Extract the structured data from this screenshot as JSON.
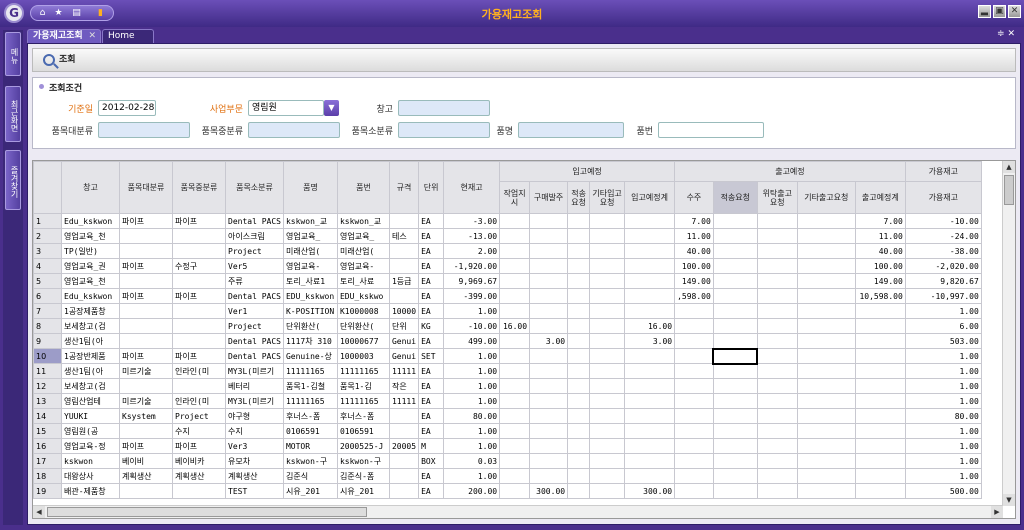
{
  "window": {
    "title": "가용재고조회",
    "logo": "G",
    "min": "▂",
    "max": "▣",
    "close": "✕"
  },
  "quickbar": {
    "icons": [
      "home-icon",
      "star-icon",
      "chart-icon",
      "folder-icon"
    ],
    "glyphs": [
      "⌂",
      "★",
      "▤",
      "▮"
    ]
  },
  "sidebar": {
    "items": [
      "메뉴",
      "최근화면",
      "즐겨찾기"
    ]
  },
  "tabs": [
    {
      "label": "가용재고조회",
      "close": "✕"
    },
    {
      "label": "Home"
    }
  ],
  "tab_controls": "≑ ✕",
  "toolbar": {
    "search_label": "조회"
  },
  "conditions": {
    "title": "조회조건",
    "base_date_label": "기준일",
    "base_date_value": "2012-02-28",
    "division_label": "사업부문",
    "division_value": "영림원",
    "warehouse_label": "창고",
    "cat_large_label": "품목대분류",
    "cat_mid_label": "품목중분류",
    "cat_small_label": "품목소분류",
    "item_name_label": "품명",
    "item_no_label": "품번"
  },
  "grid": {
    "headers": {
      "warehouse": "창고",
      "large": "품목대분류",
      "mid": "품목중분류",
      "small": "품목소분류",
      "name": "품명",
      "no": "품번",
      "spec": "규격",
      "unit": "단위",
      "stock": "현재고",
      "in_group": "입고예정",
      "in_cols": [
        "작업지시",
        "구매발주",
        "적송요청",
        "기타입고요청",
        "입고예정계"
      ],
      "out_group": "출고예정",
      "out_cols": [
        "수주",
        "적송요청",
        "위탁출고요청",
        "기타출고요청",
        "출고예정계"
      ],
      "avail_group": "가용재고",
      "avail": "가용재고"
    },
    "rows": [
      [
        "1",
        "Edu_kskwon",
        "파이프",
        "파이프",
        "Dental PACS",
        "kskwon_교",
        "kskwon_교",
        "",
        "EA",
        "-3.00",
        "",
        "",
        "",
        "",
        "",
        "7.00",
        "",
        "",
        "",
        "7.00",
        "-10.00"
      ],
      [
        "2",
        "영업교육_천",
        "",
        "",
        "아이스크림",
        "영업교육_",
        "영업교육_",
        "테스",
        "EA",
        "-13.00",
        "",
        "",
        "",
        "",
        "",
        "11.00",
        "",
        "",
        "",
        "11.00",
        "-24.00"
      ],
      [
        "3",
        "TP(일반)",
        "",
        "",
        "Project",
        "미래산업(",
        "미래산업(",
        "",
        "EA",
        "2.00",
        "",
        "",
        "",
        "",
        "",
        "40.00",
        "",
        "",
        "",
        "40.00",
        "-38.00"
      ],
      [
        "4",
        "영업교육_권",
        "파이프",
        "수정구",
        "Ver5",
        "영업교육-",
        "영업교육-",
        "",
        "EA",
        "-1,920.00",
        "",
        "",
        "",
        "",
        "",
        "100.00",
        "",
        "",
        "",
        "100.00",
        "-2,020.00"
      ],
      [
        "5",
        "영업교육_천",
        "",
        "",
        "주류",
        "토리_사료1",
        "토리_사료",
        "1등급",
        "EA",
        "9,969.67",
        "",
        "",
        "",
        "",
        "",
        "149.00",
        "",
        "",
        "",
        "149.00",
        "9,820.67"
      ],
      [
        "6",
        "Edu_kskwon",
        "파이프",
        "파이프",
        "Dental PACS",
        "EDU_kskwon",
        "EDU_kskwo",
        "",
        "EA",
        "-399.00",
        "",
        "",
        "",
        "",
        "",
        ",598.00",
        "",
        "",
        "",
        "10,598.00",
        "-10,997.00"
      ],
      [
        "7",
        "1공장제품창",
        "",
        "",
        "Ver1",
        "K-POSITION",
        "K1000008",
        "10000",
        "EA",
        "1.00",
        "",
        "",
        "",
        "",
        "",
        "",
        "",
        "",
        "",
        "",
        "1.00"
      ],
      [
        "8",
        "보세창고(검",
        "",
        "",
        "Project",
        "단위환산(",
        "단위환산(",
        "단위",
        "KG",
        "-10.00",
        "16.00",
        "",
        "",
        "",
        "16.00",
        "",
        "",
        "",
        "",
        "",
        "6.00"
      ],
      [
        "9",
        "생산1팀(아",
        "",
        "",
        "Dental PACS",
        "1117차 310",
        "10000677",
        "Genui",
        "EA",
        "499.00",
        "",
        "3.00",
        "",
        "",
        "3.00",
        "",
        "",
        "",
        "",
        "",
        "503.00"
      ],
      [
        "10",
        "1공장반제품",
        "파이프",
        "파이프",
        "Dental PACS",
        "Genuine-상",
        "1000003",
        "Genui",
        "SET",
        "1.00",
        "",
        "",
        "",
        "",
        "",
        "",
        "",
        "",
        "",
        "",
        "1.00"
      ],
      [
        "11",
        "생산1팀(아",
        "미르기술",
        "인라인(미",
        "MY3L(미르기",
        "11111165",
        "11111165",
        "11111",
        "EA",
        "1.00",
        "",
        "",
        "",
        "",
        "",
        "",
        "",
        "",
        "",
        "",
        "1.00"
      ],
      [
        "12",
        "보세창고(검",
        "",
        "",
        "베터리",
        "품목1-김철",
        "품목1-김",
        "작은",
        "EA",
        "1.00",
        "",
        "",
        "",
        "",
        "",
        "",
        "",
        "",
        "",
        "",
        "1.00"
      ],
      [
        "13",
        "영림산업테",
        "미르기술",
        "인라인(미",
        "MY3L(미르기",
        "11111165",
        "11111165",
        "11111",
        "EA",
        "1.00",
        "",
        "",
        "",
        "",
        "",
        "",
        "",
        "",
        "",
        "",
        "1.00"
      ],
      [
        "14",
        "YUUKI",
        "Ksystem",
        "Project",
        "야구형",
        "후너스-폼",
        "후너스-폼",
        "",
        "EA",
        "80.00",
        "",
        "",
        "",
        "",
        "",
        "",
        "",
        "",
        "",
        "",
        "80.00"
      ],
      [
        "15",
        "영림원(공",
        "",
        "수지",
        "수지",
        "0106591",
        "0106591",
        "",
        "EA",
        "1.00",
        "",
        "",
        "",
        "",
        "",
        "",
        "",
        "",
        "",
        "",
        "1.00"
      ],
      [
        "16",
        "영업교육-정",
        "파이프",
        "파이프",
        "Ver3",
        "MOTOR",
        "2000525-J",
        "20005",
        "M",
        "1.00",
        "",
        "",
        "",
        "",
        "",
        "",
        "",
        "",
        "",
        "",
        "1.00"
      ],
      [
        "17",
        "kskwon",
        "베이비",
        "베이비카",
        "유모차",
        "kskwon-구",
        "kskwon-구",
        "",
        "BOX",
        "0.03",
        "",
        "",
        "",
        "",
        "",
        "",
        "",
        "",
        "",
        "",
        "1.00"
      ],
      [
        "18",
        "대왕상사",
        "계획생산",
        "계획생산",
        "계획생산",
        "김준식",
        "김준식-폼",
        "",
        "EA",
        "1.00",
        "",
        "",
        "",
        "",
        "",
        "",
        "",
        "",
        "",
        "",
        "1.00"
      ],
      [
        "19",
        "배관-제품창",
        "",
        "",
        "TEST",
        "시유_201",
        "시유_201",
        "",
        "EA",
        "200.00",
        "",
        "300.00",
        "",
        "",
        "300.00",
        "",
        "",
        "",
        "",
        "",
        "500.00"
      ]
    ]
  }
}
